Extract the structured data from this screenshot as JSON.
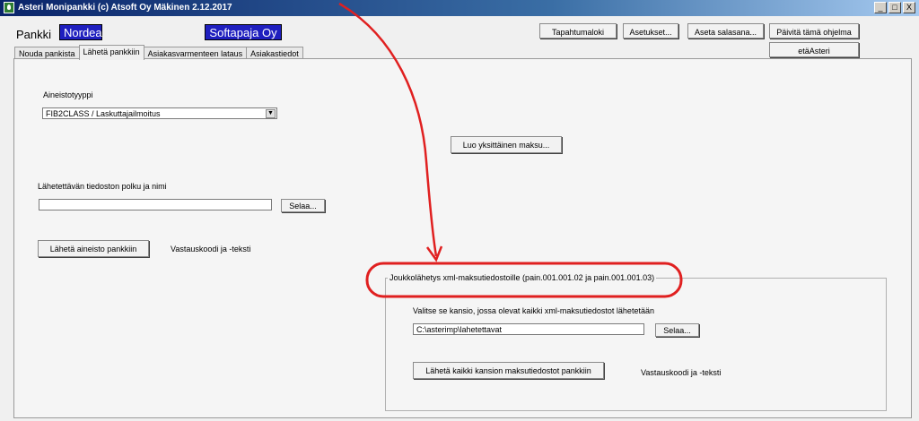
{
  "window": {
    "title": "Asteri Monipankki  (c) Atsoft Oy Mäkinen 2.12.2017",
    "controls": [
      "_",
      "□",
      "X"
    ]
  },
  "header": {
    "pankki_label": "Pankki",
    "bank_name": "Nordea",
    "company": "Softapaja Oy",
    "buttons": {
      "tapahtumaloki": "Tapahtumaloki",
      "asetukset": "Asetukset...",
      "aseta_salasana": "Aseta salasana...",
      "paivita": "Päivitä tämä ohjelma",
      "etaasteri": "etäAsteri"
    }
  },
  "tabs": [
    {
      "label": "Nouda pankista"
    },
    {
      "label": "Lähetä pankkiin"
    },
    {
      "label": "Asiakasvarmenteen lataus"
    },
    {
      "label": "Asiakastiedot"
    }
  ],
  "main": {
    "aineistotyyppi_label": "Aineistotyyppi",
    "aineistotyyppi_value": "FIB2CLASS / Laskuttajailmoitus",
    "luo_maksu": "Luo yksittäinen maksu...",
    "polku_label": "Lähetettävän tiedoston polku ja nimi",
    "polku_value": "",
    "selaa": "Selaa...",
    "laheta": "Lähetä aineisto pankkiin",
    "vastaus": "Vastauskoodi ja -teksti"
  },
  "group": {
    "title": "Joukkolähetys xml-maksutiedostoille (pain.001.001.02 ja pain.001.001.03)",
    "kansio_label": "Valitse se kansio, jossa olevat kaikki xml-maksutiedostot lähetetään",
    "kansio_value": "C:\\asterimp\\lahetettavat",
    "selaa": "Selaa...",
    "laheta_kaikki": "Lähetä kaikki kansion maksutiedostot pankkiin",
    "vastaus": "Vastauskoodi ja -teksti"
  },
  "annotation": {
    "color": "#e02020"
  }
}
